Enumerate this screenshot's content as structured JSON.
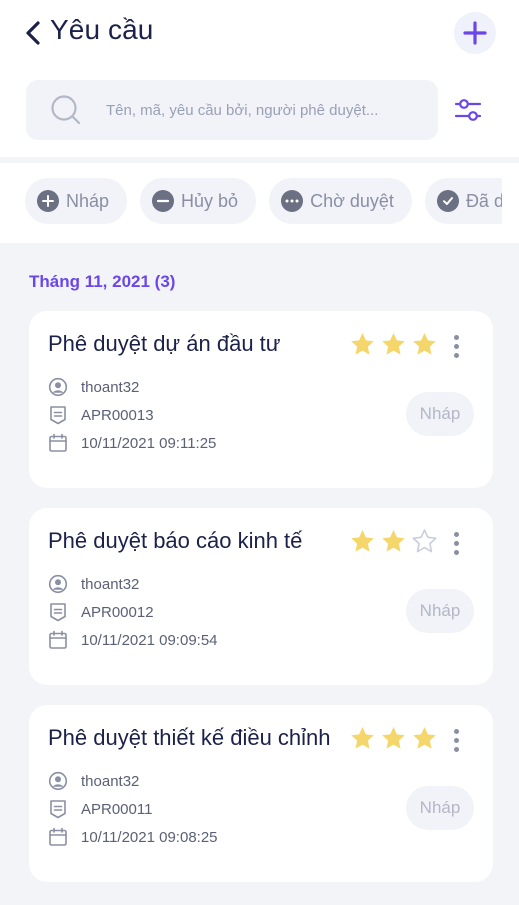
{
  "header": {
    "title": "Yêu cầu"
  },
  "search": {
    "placeholder": "Tên, mã, yêu cầu bởi, người phê duyệt..."
  },
  "chips": [
    {
      "label": "Nháp",
      "icon": "plus-circle-icon"
    },
    {
      "label": "Hủy bỏ",
      "icon": "minus-circle-icon"
    },
    {
      "label": "Chờ duyệt",
      "icon": "dots-circle-icon"
    },
    {
      "label": "Đã duyệt",
      "icon": "check-circle-icon"
    }
  ],
  "section": {
    "title": "Tháng 11, 2021 (3)"
  },
  "requests": [
    {
      "title": "Phê duyệt dự án đầu tư",
      "rating": 3,
      "rating_max": 3,
      "user": "thoant32",
      "code": "APR00013",
      "datetime": "10/11/2021 09:11:25",
      "status": "Nháp"
    },
    {
      "title": "Phê duyệt báo cáo kinh tế",
      "rating": 2,
      "rating_max": 3,
      "user": "thoant32",
      "code": "APR00012",
      "datetime": "10/11/2021 09:09:54",
      "status": "Nháp"
    },
    {
      "title": "Phê duyệt thiết kế điều chỉnh",
      "rating": 3,
      "rating_max": 3,
      "user": "thoant32",
      "code": "APR00011",
      "datetime": "10/11/2021 09:08:25",
      "status": "Nháp"
    }
  ],
  "colors": {
    "accent": "#6a47e6",
    "title": "#1b2149",
    "star": "#f5d66a",
    "star_empty": "#c9cdda"
  }
}
